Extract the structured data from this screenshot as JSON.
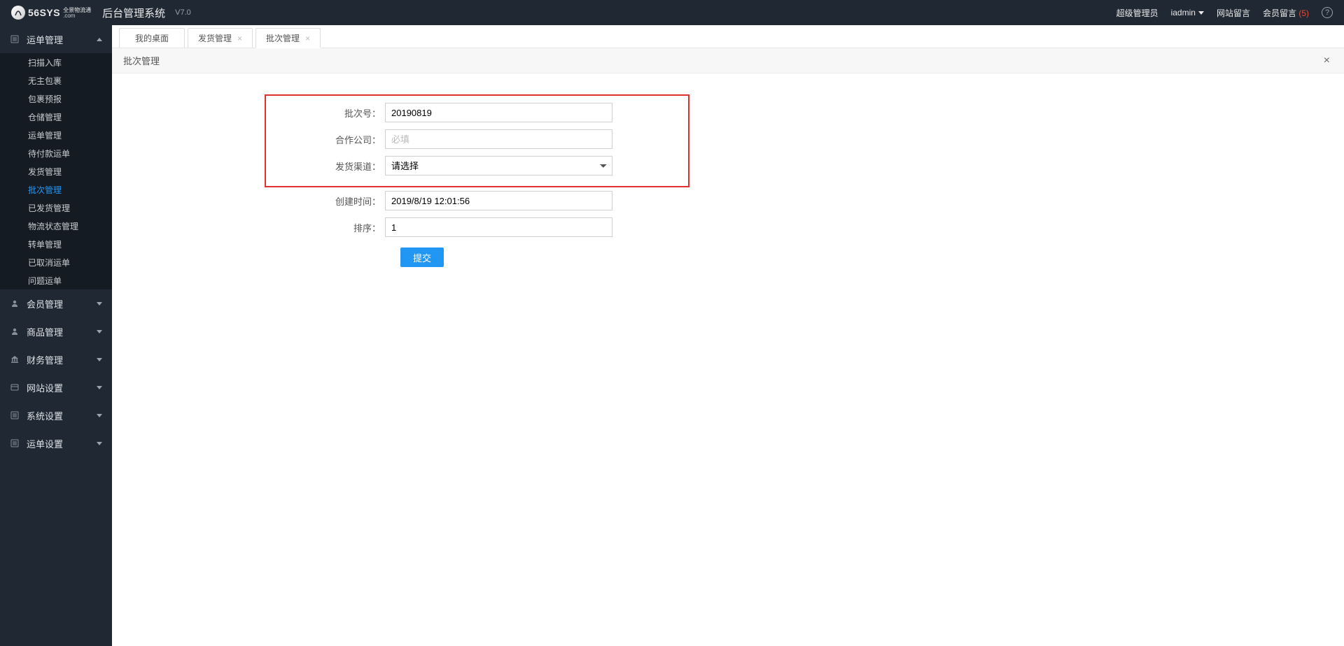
{
  "header": {
    "logo_main": "56SYS",
    "logo_domain": ".com",
    "logo_tagline": "全景物流通",
    "system_title": "后台管理系统",
    "version": "V7.0",
    "role_label": "超级管理员",
    "username": "iadmin",
    "site_msg_label": "网站留言",
    "member_msg_label": "会员留言",
    "member_msg_count": "(5)"
  },
  "sidebar": {
    "groups": [
      {
        "label": "运单管理",
        "expanded": true,
        "items": [
          "扫描入库",
          "无主包裹",
          "包裹预报",
          "仓储管理",
          "运单管理",
          "待付款运单",
          "发货管理",
          "批次管理",
          "已发货管理",
          "物流状态管理",
          "转单管理",
          "已取消运单",
          "问题运单"
        ],
        "active_index": 7
      },
      {
        "label": "会员管理",
        "expanded": false
      },
      {
        "label": "商品管理",
        "expanded": false
      },
      {
        "label": "财务管理",
        "expanded": false
      },
      {
        "label": "网站设置",
        "expanded": false
      },
      {
        "label": "系统设置",
        "expanded": false
      },
      {
        "label": "运单设置",
        "expanded": false
      }
    ]
  },
  "tabs": [
    {
      "label": "我的桌面",
      "closable": false,
      "active": false
    },
    {
      "label": "发货管理",
      "closable": true,
      "active": false
    },
    {
      "label": "批次管理",
      "closable": true,
      "active": true
    }
  ],
  "page": {
    "title": "批次管理"
  },
  "form": {
    "batch_no_label": "批次号：",
    "batch_no_value": "20190819",
    "partner_label": "合作公司：",
    "partner_placeholder": "必填",
    "partner_value": "",
    "channel_label": "发货渠道：",
    "channel_selected": "请选择",
    "created_label": "创建时间：",
    "created_value": "2019/8/19 12:01:56",
    "sort_label": "排序：",
    "sort_value": "1",
    "submit_label": "提交"
  }
}
